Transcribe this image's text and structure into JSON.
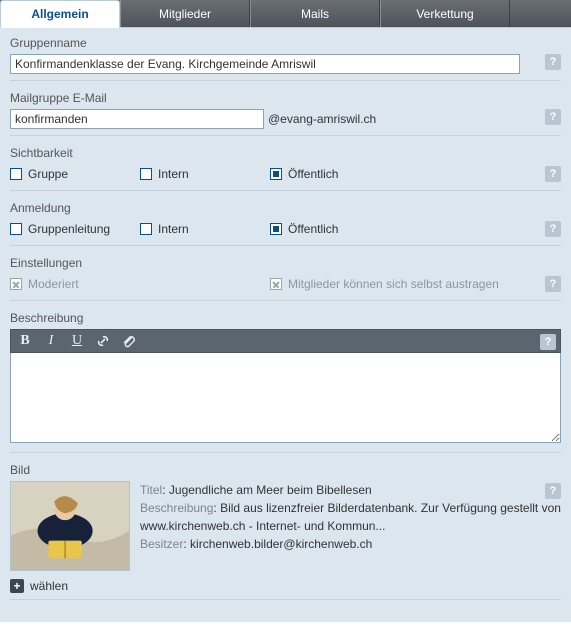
{
  "tabs": {
    "general": "Allgemein",
    "members": "Mitglieder",
    "mails": "Mails",
    "chain": "Verkettung"
  },
  "group_name": {
    "label": "Gruppenname",
    "value": "Konfirmandenklasse der Evang. Kirchgemeinde Amriswil"
  },
  "mail_group": {
    "label": "Mailgruppe E-Mail",
    "value": "konfirmanden",
    "suffix": "@evang-amriswil.ch"
  },
  "visibility": {
    "label": "Sichtbarkeit",
    "options": {
      "group": "Gruppe",
      "intern": "Intern",
      "public": "Öffentlich"
    }
  },
  "registration": {
    "label": "Anmeldung",
    "options": {
      "leadership": "Gruppenleitung",
      "intern": "Intern",
      "public": "Öffentlich"
    }
  },
  "settings": {
    "label": "Einstellungen",
    "options": {
      "moderated": "Moderiert",
      "self_remove": "Mitglieder können sich selbst austragen"
    }
  },
  "description": {
    "label": "Beschreibung",
    "value": ""
  },
  "image": {
    "label": "Bild",
    "title_key": "Titel",
    "title_val": "Jugendliche am Meer beim Bibellesen",
    "desc_key": "Beschreibung",
    "desc_val": "Bild aus lizenzfreier Bilderdatenbank. Zur Verfügung gestellt von www.kirchenweb.ch - Internet- und Kommun...",
    "owner_key": "Besitzer",
    "owner_val": "kirchenweb.bilder@kirchenweb.ch",
    "choose": "wählen"
  },
  "help_glyph": "?"
}
